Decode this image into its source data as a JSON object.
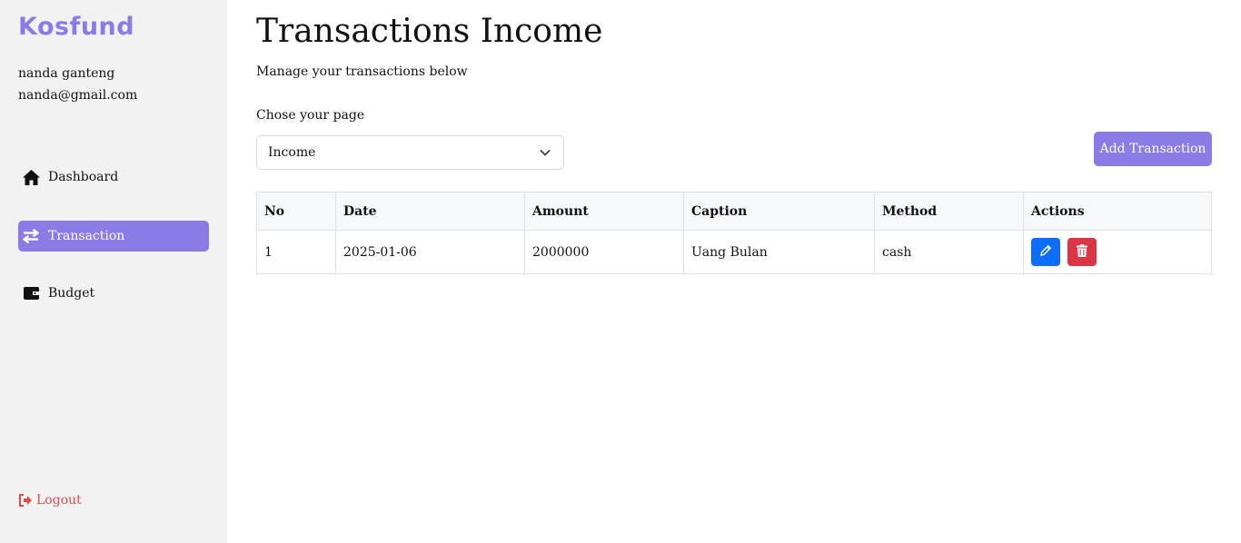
{
  "brand": "Kosfund",
  "user": {
    "name": "nanda ganteng",
    "email": "nanda@gmail.com"
  },
  "nav": {
    "dashboard": {
      "label": "Dashboard",
      "icon": "home-icon"
    },
    "transaction": {
      "label": "Transaction",
      "icon": "swap-arrows-icon"
    },
    "budget": {
      "label": "Budget",
      "icon": "wallet-icon"
    }
  },
  "logout": {
    "label": "Logout",
    "icon": "sign-out-icon"
  },
  "page": {
    "title": "Transactions Income",
    "subtitle": "Manage your transactions below",
    "select_label": "Chose your page",
    "select_value": "Income"
  },
  "add_button": "Add Transaction",
  "table": {
    "headers": [
      "No",
      "Date",
      "Amount",
      "Caption",
      "Method",
      "Actions"
    ],
    "rows": [
      {
        "no": "1",
        "date": "2025-01-06",
        "amount": "2000000",
        "caption": "Uang Bulan",
        "method": "cash"
      }
    ]
  },
  "colors": {
    "accent": "#8b7be6",
    "sidebar_bg": "#f2f2f2",
    "edit": "#0d6efd",
    "delete": "#dc3545",
    "logout": "#dc4c4c"
  }
}
